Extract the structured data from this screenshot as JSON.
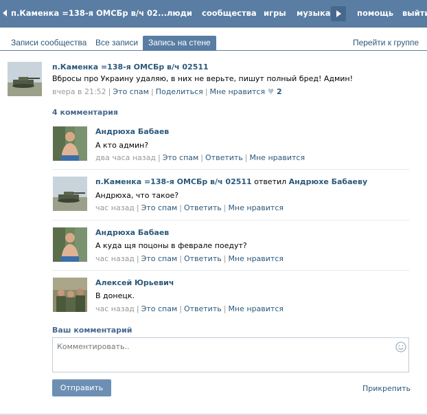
{
  "header": {
    "title": "п.Каменка =138-я ОМСБр в/ч 02...",
    "nav": [
      "люди",
      "сообщества",
      "игры",
      "музыка"
    ],
    "nav_right": [
      "помощь",
      "выйти"
    ]
  },
  "tabs": [
    {
      "label": "Записи сообщества",
      "active": false
    },
    {
      "label": "Все записи",
      "active": false
    },
    {
      "label": "Запись на стене",
      "active": true
    }
  ],
  "tab_right": "Перейти к группе",
  "post": {
    "author": "п.Каменка =138-я ОМСБр в/ч 02511",
    "text": "Вбросы про Украину удаляю, в них не верьте, пишут полный бред! Админ!",
    "time": "вчера в 21:52",
    "actions": [
      "Это спам",
      "Поделиться",
      "Мне нравится"
    ],
    "likes": "2"
  },
  "comments_title": "4 комментария",
  "comments": [
    {
      "author": "Андрюха Бабаев",
      "reply_word": "",
      "reply_to": "",
      "text": "А кто админ?",
      "time": "два часа назад",
      "actions": [
        "Это спам",
        "Ответить",
        "Мне нравится"
      ]
    },
    {
      "author": "п.Каменка =138-я ОМСБр в/ч 02511",
      "reply_word": "ответил",
      "reply_to": "Андрюхе Бабаеву",
      "text": "Андрюха, что такое?",
      "time": "час назад",
      "actions": [
        "Это спам",
        "Ответить",
        "Мне нравится"
      ]
    },
    {
      "author": "Андрюха Бабаев",
      "reply_word": "",
      "reply_to": "",
      "text": "А куда щя поцоны в феврале поедут?",
      "time": "час назад",
      "actions": [
        "Это спам",
        "Ответить",
        "Мне нравится"
      ]
    },
    {
      "author": "Алексей Юрьевич",
      "reply_word": "",
      "reply_to": "",
      "text": "В донецк.",
      "time": "час назад",
      "actions": [
        "Это спам",
        "Ответить",
        "Мне нравится"
      ]
    }
  ],
  "reply": {
    "label": "Ваш комментарий",
    "placeholder": "Комментировать..",
    "send": "Отправить",
    "attach": "Прикрепить"
  }
}
